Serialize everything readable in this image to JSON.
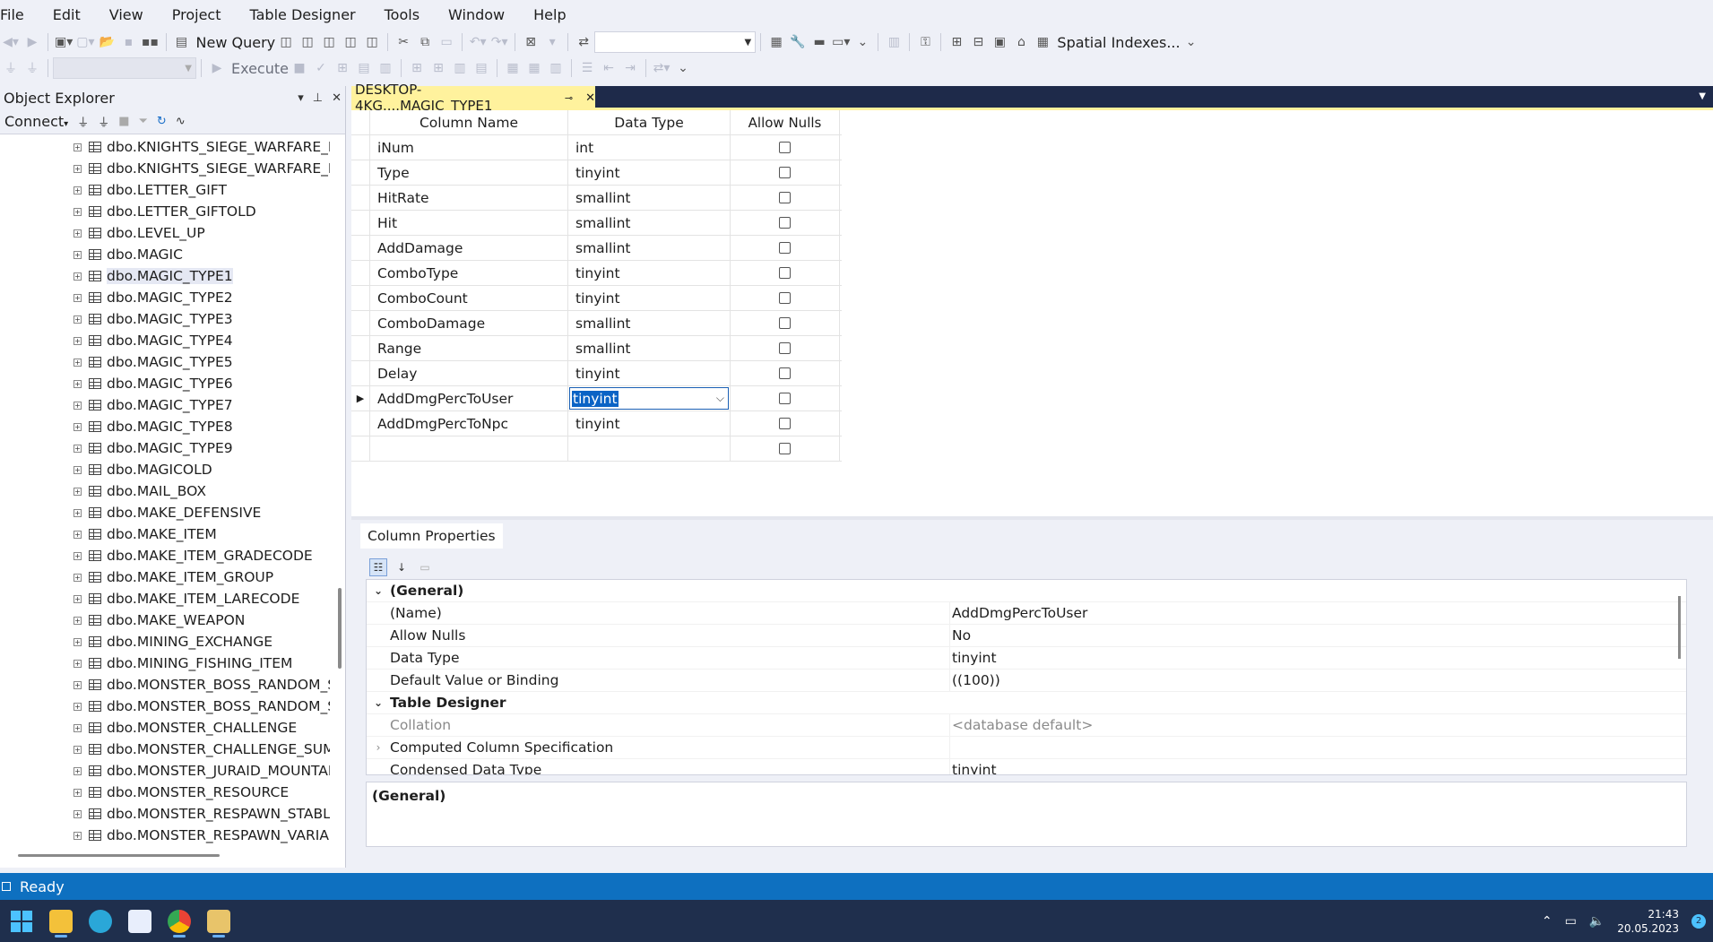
{
  "menu": [
    "File",
    "Edit",
    "View",
    "Project",
    "Table Designer",
    "Tools",
    "Window",
    "Help"
  ],
  "toolbar": {
    "new_query_label": "New Query",
    "spatial_indexes_label": "Spatial Indexes...",
    "execute_label": "Execute",
    "database_combo_value": ""
  },
  "object_explorer": {
    "title": "Object Explorer",
    "connect_label": "Connect",
    "items": [
      "dbo.KNIGHTS_SIEGE_WARFARE_RA",
      "dbo.KNIGHTS_SIEGE_WARFARE_RE",
      "dbo.LETTER_GIFT",
      "dbo.LETTER_GIFTOLD",
      "dbo.LEVEL_UP",
      "dbo.MAGIC",
      "dbo.MAGIC_TYPE1",
      "dbo.MAGIC_TYPE2",
      "dbo.MAGIC_TYPE3",
      "dbo.MAGIC_TYPE4",
      "dbo.MAGIC_TYPE5",
      "dbo.MAGIC_TYPE6",
      "dbo.MAGIC_TYPE7",
      "dbo.MAGIC_TYPE8",
      "dbo.MAGIC_TYPE9",
      "dbo.MAGICOLD",
      "dbo.MAIL_BOX",
      "dbo.MAKE_DEFENSIVE",
      "dbo.MAKE_ITEM",
      "dbo.MAKE_ITEM_GRADECODE",
      "dbo.MAKE_ITEM_GROUP",
      "dbo.MAKE_ITEM_LARECODE",
      "dbo.MAKE_WEAPON",
      "dbo.MINING_EXCHANGE",
      "dbo.MINING_FISHING_ITEM",
      "dbo.MONSTER_BOSS_RANDOM_SP",
      "dbo.MONSTER_BOSS_RANDOM_ST",
      "dbo.MONSTER_CHALLENGE",
      "dbo.MONSTER_CHALLENGE_SUMM",
      "dbo.MONSTER_JURAID_MOUNTAIN",
      "dbo.MONSTER_RESOURCE",
      "dbo.MONSTER_RESPAWN_STABLE_",
      "dbo.MONSTER_RESPAWN_VARIABL"
    ],
    "selected_index": 6
  },
  "document": {
    "tab_title": "DESKTOP-4KG....MAGIC_TYPE1",
    "grid": {
      "headers": [
        "Column Name",
        "Data Type",
        "Allow Nulls"
      ],
      "rows": [
        {
          "name": "iNum",
          "type": "int"
        },
        {
          "name": "Type",
          "type": "tinyint"
        },
        {
          "name": "HitRate",
          "type": "smallint"
        },
        {
          "name": "Hit",
          "type": "smallint"
        },
        {
          "name": "AddDamage",
          "type": "smallint"
        },
        {
          "name": "ComboType",
          "type": "tinyint"
        },
        {
          "name": "ComboCount",
          "type": "tinyint"
        },
        {
          "name": "ComboDamage",
          "type": "smallint"
        },
        {
          "name": "Range",
          "type": "smallint"
        },
        {
          "name": "Delay",
          "type": "tinyint"
        },
        {
          "name": "AddDmgPercToUser",
          "type": "tinyint"
        },
        {
          "name": "AddDmgPercToNpc",
          "type": "tinyint"
        },
        {
          "name": "",
          "type": ""
        }
      ],
      "active_row": 10
    }
  },
  "column_properties": {
    "tab_label": "Column Properties",
    "rows": [
      {
        "kind": "cat",
        "name": "(General)",
        "value": ""
      },
      {
        "kind": "prop",
        "name": "(Name)",
        "value": "AddDmgPercToUser"
      },
      {
        "kind": "prop",
        "name": "Allow Nulls",
        "value": "No"
      },
      {
        "kind": "prop",
        "name": "Data Type",
        "value": "tinyint"
      },
      {
        "kind": "prop",
        "name": "Default Value or Binding",
        "value": "((100))"
      },
      {
        "kind": "cat",
        "name": "Table Designer",
        "value": ""
      },
      {
        "kind": "grey",
        "name": "Collation",
        "value": "<database default>"
      },
      {
        "kind": "expand",
        "name": "Computed Column Specification",
        "value": ""
      },
      {
        "kind": "prop",
        "name": "Condensed Data Type",
        "value": "tinyint"
      }
    ],
    "description_title": "(General)"
  },
  "status": {
    "text": "Ready"
  },
  "taskbar": {
    "time": "21:43",
    "date": "20.05.2023",
    "notification_count": "2"
  },
  "colors": {
    "accent": "#0e70c0",
    "tab_active": "#fff29d",
    "tabstrip": "#1e2a4a",
    "taskbar": "#1f2f4d"
  }
}
